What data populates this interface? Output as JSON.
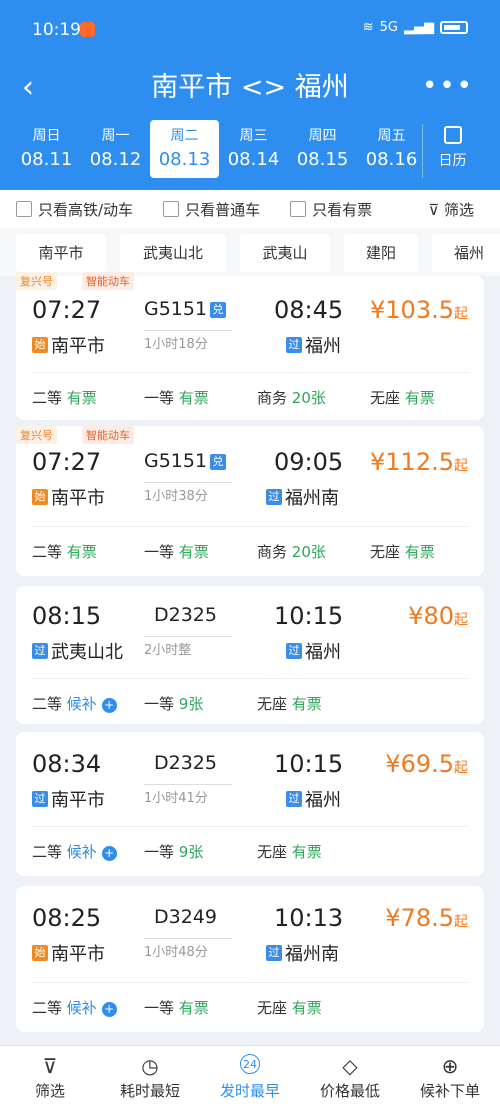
{
  "status": {
    "time": "10:19",
    "net": "5G"
  },
  "header": {
    "title": "南平市 <> 福州",
    "back": "‹",
    "more": "•••"
  },
  "days": [
    {
      "w": "周日",
      "d": "08.11"
    },
    {
      "w": "周一",
      "d": "08.12"
    },
    {
      "w": "周二",
      "d": "08.13"
    },
    {
      "w": "周三",
      "d": "08.14"
    },
    {
      "w": "周四",
      "d": "08.15"
    },
    {
      "w": "周五",
      "d": "08.16"
    }
  ],
  "calendar": "日历",
  "filters": {
    "a": "只看高铁/动车",
    "b": "只看普通车",
    "c": "只看有票",
    "screen": "筛选"
  },
  "stations": [
    "南平市",
    "武夷山北",
    "武夷山",
    "建阳",
    "福州"
  ],
  "trains": [
    {
      "tag1": "复兴号",
      "tag2": "智能动车",
      "dep": "07:27",
      "no": "G5151",
      "dur": "1小时18分",
      "arr": "08:45",
      "from": "南平市",
      "fromMark": "始",
      "to": "福州",
      "toMark": "过",
      "price": "103.5",
      "s1": "二等",
      "s1v": "有票",
      "s2": "一等",
      "s2v": "有票",
      "s3": "商务",
      "s3v": "20张",
      "s4": "无座",
      "s4v": "有票"
    },
    {
      "tag1": "复兴号",
      "tag2": "智能动车",
      "dep": "07:27",
      "no": "G5151",
      "dur": "1小时38分",
      "arr": "09:05",
      "from": "南平市",
      "fromMark": "始",
      "to": "福州南",
      "toMark": "过",
      "price": "112.5",
      "s1": "二等",
      "s1v": "有票",
      "s2": "一等",
      "s2v": "有票",
      "s3": "商务",
      "s3v": "20张",
      "s4": "无座",
      "s4v": "有票"
    },
    {
      "dep": "08:15",
      "no": "D2325",
      "dur": "2小时整",
      "arr": "10:15",
      "from": "武夷山北",
      "fromMark": "过",
      "to": "福州",
      "toMark": "过",
      "price": "80",
      "s1": "二等",
      "s1v": "候补",
      "s2": "一等",
      "s2v": "9张",
      "s3": "无座",
      "s3v": "有票"
    },
    {
      "dep": "08:34",
      "no": "D2325",
      "dur": "1小时41分",
      "arr": "10:15",
      "from": "南平市",
      "fromMark": "过",
      "to": "福州",
      "toMark": "过",
      "price": "69.5",
      "s1": "二等",
      "s1v": "候补",
      "s2": "一等",
      "s2v": "9张",
      "s3": "无座",
      "s3v": "有票"
    },
    {
      "dep": "08:25",
      "no": "D3249",
      "dur": "1小时48分",
      "arr": "10:13",
      "from": "南平市",
      "fromMark": "始",
      "to": "福州南",
      "toMark": "过",
      "price": "78.5",
      "s1": "二等",
      "s1v": "候补",
      "s2": "一等",
      "s2v": "有票",
      "s3": "无座",
      "s3v": "有票"
    }
  ],
  "yuan": "¥",
  "qi": "起",
  "exchange": "兑",
  "tabs": [
    "筛选",
    "耗时最短",
    "发时最早",
    "价格最低",
    "候补下单"
  ],
  "tabIcons": {
    "t3": "24"
  }
}
